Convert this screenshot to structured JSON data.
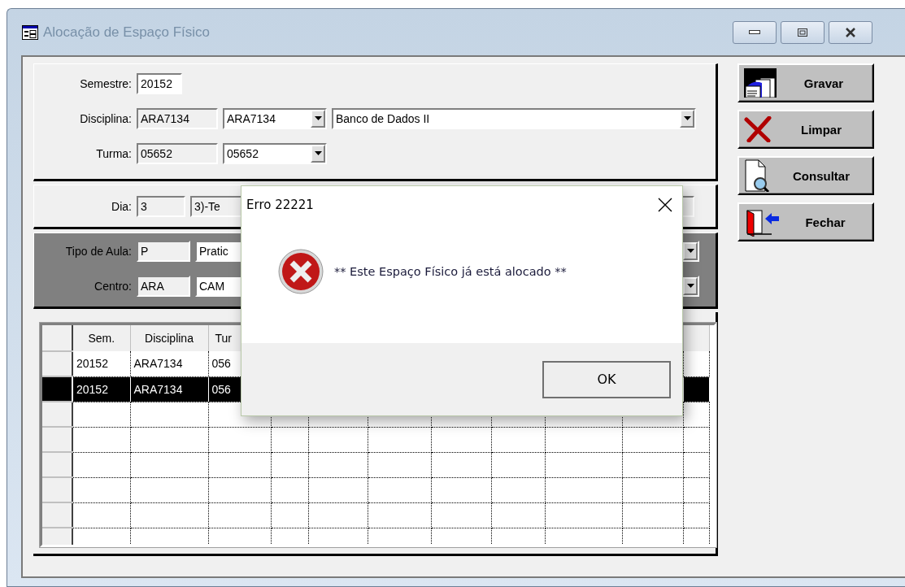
{
  "window": {
    "title": "Alocação de Espaço Físico"
  },
  "course_section": {
    "semestre": {
      "label": "Semestre:",
      "value": "20152"
    },
    "disciplina": {
      "label": "Disciplina:",
      "code": "ARA7134",
      "combo": "ARA7134",
      "name": "Banco de Dados II"
    },
    "turma": {
      "label": "Turma:",
      "code": "05652",
      "combo": "05652"
    }
  },
  "day_section": {
    "label": "Dia:",
    "code": "3",
    "description": "3)-Te"
  },
  "type_section": {
    "tipo": {
      "label": "Tipo de Aula:",
      "code": "P",
      "description": "Pratic"
    },
    "centro": {
      "label": "Centro:",
      "code": "ARA",
      "description": "CAM"
    }
  },
  "grid": {
    "columns": [
      "Sem.",
      "Disciplina",
      "Tur"
    ],
    "rows": [
      {
        "cells": [
          "20152",
          "ARA7134",
          "056"
        ],
        "selected": false
      },
      {
        "cells": [
          "20152",
          "ARA7134",
          "056"
        ],
        "selected": true
      }
    ]
  },
  "buttons": [
    {
      "label": "Gravar",
      "kind": "save"
    },
    {
      "label": "Limpar",
      "kind": "clear"
    },
    {
      "label": "Consultar",
      "kind": "query"
    },
    {
      "label": "Fechar",
      "kind": "close"
    }
  ],
  "dialog": {
    "title": "Erro 22221",
    "message": "** Este Espaço Físico já está alocado **",
    "button": "OK"
  }
}
